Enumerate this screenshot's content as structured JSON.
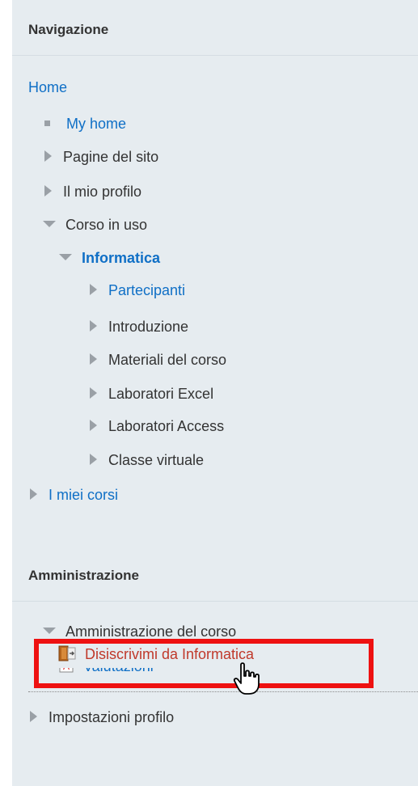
{
  "navigation": {
    "title": "Navigazione",
    "home": "Home",
    "my_home": "My home",
    "pagine_del_sito": "Pagine del sito",
    "il_mio_profilo": "Il mio profilo",
    "corso_in_uso": "Corso in uso",
    "course_name": "Informatica",
    "course_sections": [
      "Partecipanti",
      "Introduzione",
      "Materiali del corso",
      "Laboratori Excel",
      "Laboratori Access",
      "Classe virtuale"
    ],
    "i_miei_corsi": "I miei corsi"
  },
  "administration": {
    "title": "Amministrazione",
    "course_admin": "Amministrazione del corso",
    "unenrol": "Disiscrivimi da Informatica",
    "grades": "Valutazioni",
    "profile_settings": "Impostazioni profilo"
  },
  "colors": {
    "link": "#0f6fc6",
    "panel_bg": "#e6ecf0",
    "highlight_border": "#ee1111",
    "unenrol_text": "#c0392b"
  }
}
